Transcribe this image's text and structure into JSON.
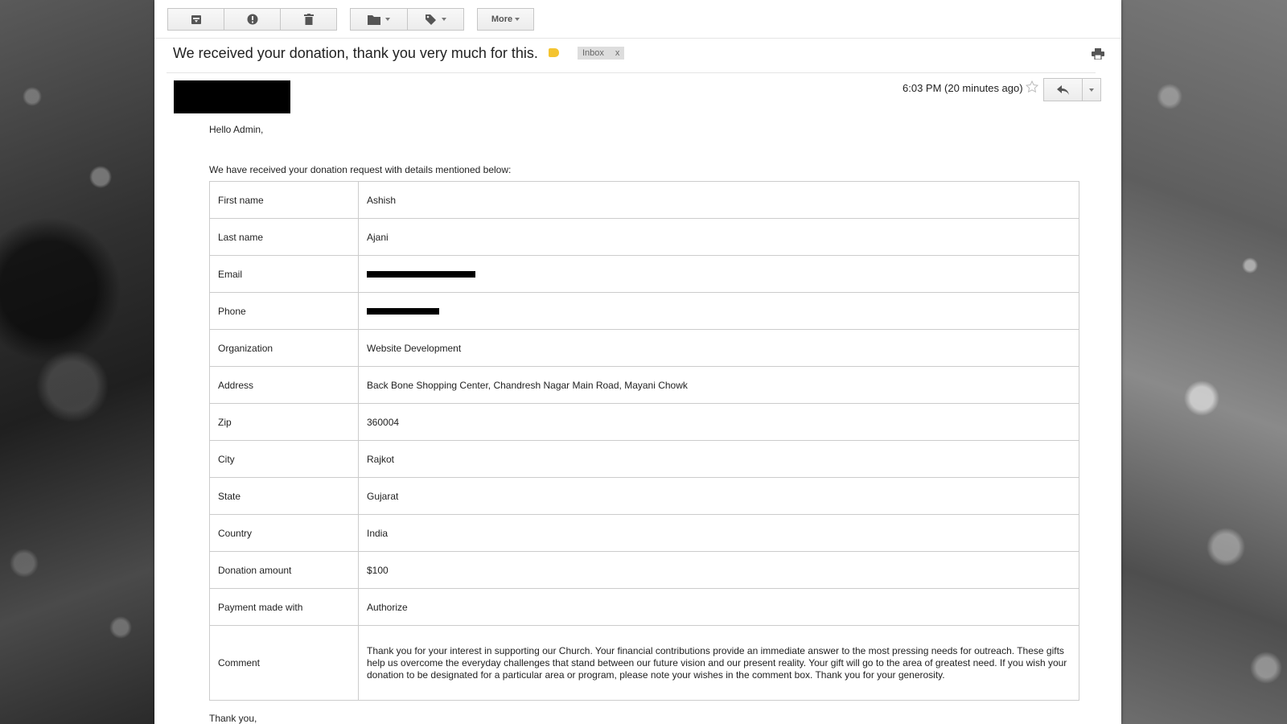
{
  "toolbar": {
    "archive_icon": "archive-icon",
    "spam_icon": "report-spam-icon",
    "delete_icon": "trash-icon",
    "move_icon": "folder-icon",
    "labels_icon": "tag-icon",
    "more_label": "More"
  },
  "email": {
    "subject": "We received your donation, thank you very much for this.",
    "label_badge": "Inbox",
    "label_remove": "x",
    "timestamp": "6:03 PM (20 minutes ago)",
    "greeting": "Hello Admin,",
    "intro": "We have received your donation request with details mentioned below:",
    "closing": "Thank you,"
  },
  "details": [
    {
      "key": "First name",
      "value": "Ashish"
    },
    {
      "key": "Last name",
      "value": "Ajani"
    },
    {
      "key": "Email",
      "value": ""
    },
    {
      "key": "Phone",
      "value": ""
    },
    {
      "key": "Organization",
      "value": "Website Development"
    },
    {
      "key": "Address",
      "value": "Back Bone Shopping Center, Chandresh Nagar Main Road, Mayani Chowk"
    },
    {
      "key": "Zip",
      "value": "360004"
    },
    {
      "key": "City",
      "value": "Rajkot"
    },
    {
      "key": "State",
      "value": "Gujarat"
    },
    {
      "key": "Country",
      "value": "India"
    },
    {
      "key": "Donation amount",
      "value": "$100"
    },
    {
      "key": "Payment made with",
      "value": "Authorize"
    },
    {
      "key": "Comment",
      "value": "Thank you for your interest in supporting our Church. Your financial contributions provide an immediate answer to the most pressing needs for outreach. These gifts help us overcome the everyday challenges that stand between our future vision and our present reality. Your gift will go to the area of greatest need. If you wish your donation to be designated for a particular area or program, please note your wishes in the comment box. Thank you for your generosity."
    }
  ],
  "colors": {
    "label_tag": "#f4c430",
    "badge_bg": "#dddddd"
  }
}
